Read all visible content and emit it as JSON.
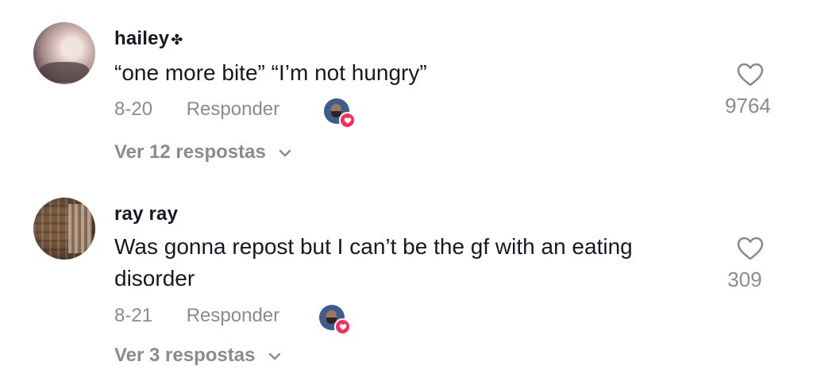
{
  "comments": [
    {
      "username": "hailey",
      "username_decoration": "✤",
      "text": "“one more bite”  “I’m not hungry”",
      "date": "8-20",
      "reply_label": "Responder",
      "view_replies_label": "Ver 12 respostas",
      "like_count": "9764"
    },
    {
      "username": "ray ray",
      "text": "Was gonna repost but I can’t be the gf with an eating disorder",
      "date": "8-21",
      "reply_label": "Responder",
      "view_replies_label": "Ver 3 respostas",
      "like_count": "309"
    }
  ],
  "icons": {
    "like": "heart-outline-icon",
    "creator_liked_badge": "heart-badge-icon",
    "expand": "chevron-down-icon"
  },
  "colors": {
    "primary_text": "#161823",
    "secondary_text": "#8a8b91",
    "badge": "#fe2c55"
  }
}
